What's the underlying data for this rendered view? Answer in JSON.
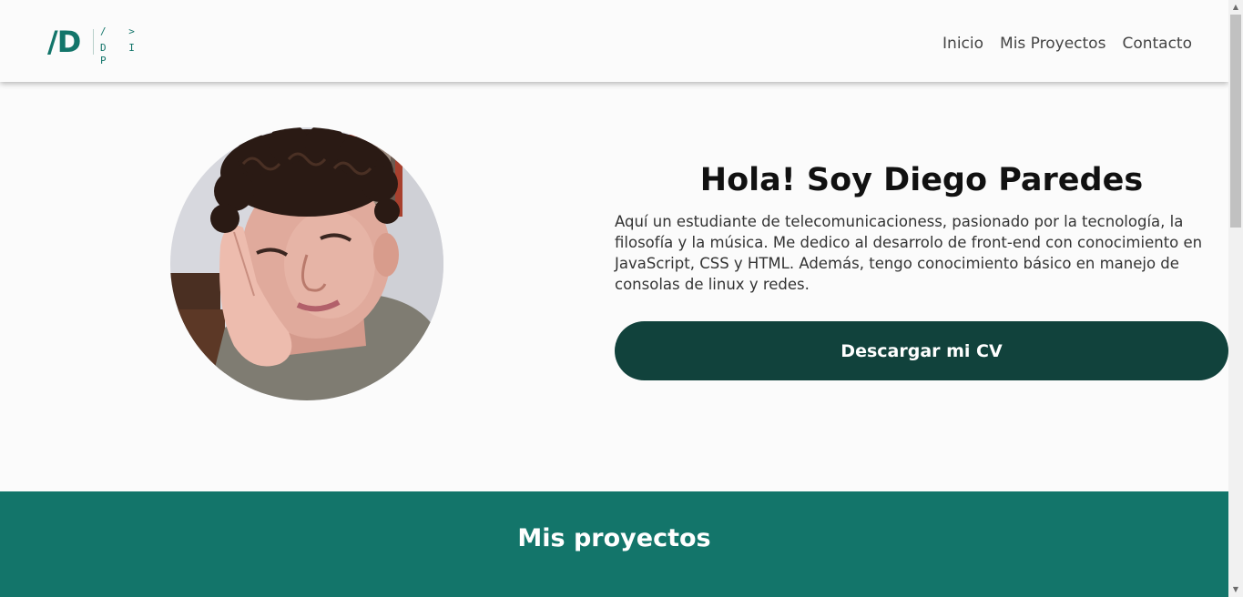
{
  "logo": {
    "mark": "/D",
    "top": "/ >",
    "bottom": "D I P"
  },
  "nav": {
    "items": [
      {
        "label": "Inicio"
      },
      {
        "label": "Mis Proyectos"
      },
      {
        "label": "Contacto"
      }
    ]
  },
  "hero": {
    "title": "Hola! Soy Diego Paredes",
    "description": "Aquí un estudiante de telecomunicacioness, pasionado por la tecnología, la filosofía y la música. Me dedico al desarrolo de front-end con conocimiento en JavaScript, CSS y HTML. Además, tengo conocimiento básico en manejo de consolas de linux y redes.",
    "cv_button": "Descargar mi CV"
  },
  "projects": {
    "title": "Mis proyectos"
  },
  "colors": {
    "brand": "#13756a",
    "button": "#11423c",
    "background": "#fbfbfb"
  }
}
